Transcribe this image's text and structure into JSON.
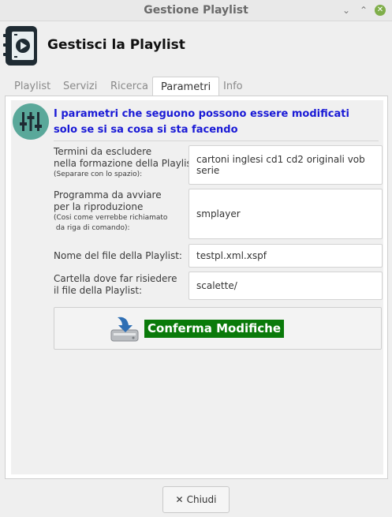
{
  "window": {
    "title": "Gestione Playlist",
    "minimize": "⌄",
    "maximize": "⌃",
    "close": "✕"
  },
  "header": {
    "title": "Gestisci la Playlist"
  },
  "tabs": [
    {
      "label": "Playlist"
    },
    {
      "label": "Servizi"
    },
    {
      "label": "Ricerca"
    },
    {
      "label": "Parametri"
    },
    {
      "label": "Info"
    }
  ],
  "panel": {
    "warning_line1": "I parametri che seguono possono essere modificati",
    "warning_line2": "solo se si sa cosa si sta facendo",
    "fields": {
      "exclude": {
        "label1": "Termini da escludere",
        "label2": "nella formazione della Playlist",
        "note": "(Separare con lo spazio):",
        "value": "cartoni inglesi cd1 cd2 originali vob serie"
      },
      "program": {
        "label1": "Programma da avviare",
        "label2": "per la riproduzione",
        "note1": "(Cosi come verrebbe richiamato",
        "note2": " da riga di comando):",
        "value": "smplayer"
      },
      "filename": {
        "label": "Nome del file della Playlist:",
        "value": "testpl.xml.xspf"
      },
      "folder": {
        "label1": "Cartella dove far risiedere",
        "label2": "il file della Playlist:",
        "value": "scalette/"
      }
    },
    "confirm_label": "Conferma Modifiche"
  },
  "footer": {
    "close_x": "✕",
    "close_label": "Chiudi"
  },
  "colors": {
    "accent_blue": "#1a1ad6",
    "confirm_green": "#0a7a0a",
    "icon_teal": "#5aa89a"
  }
}
